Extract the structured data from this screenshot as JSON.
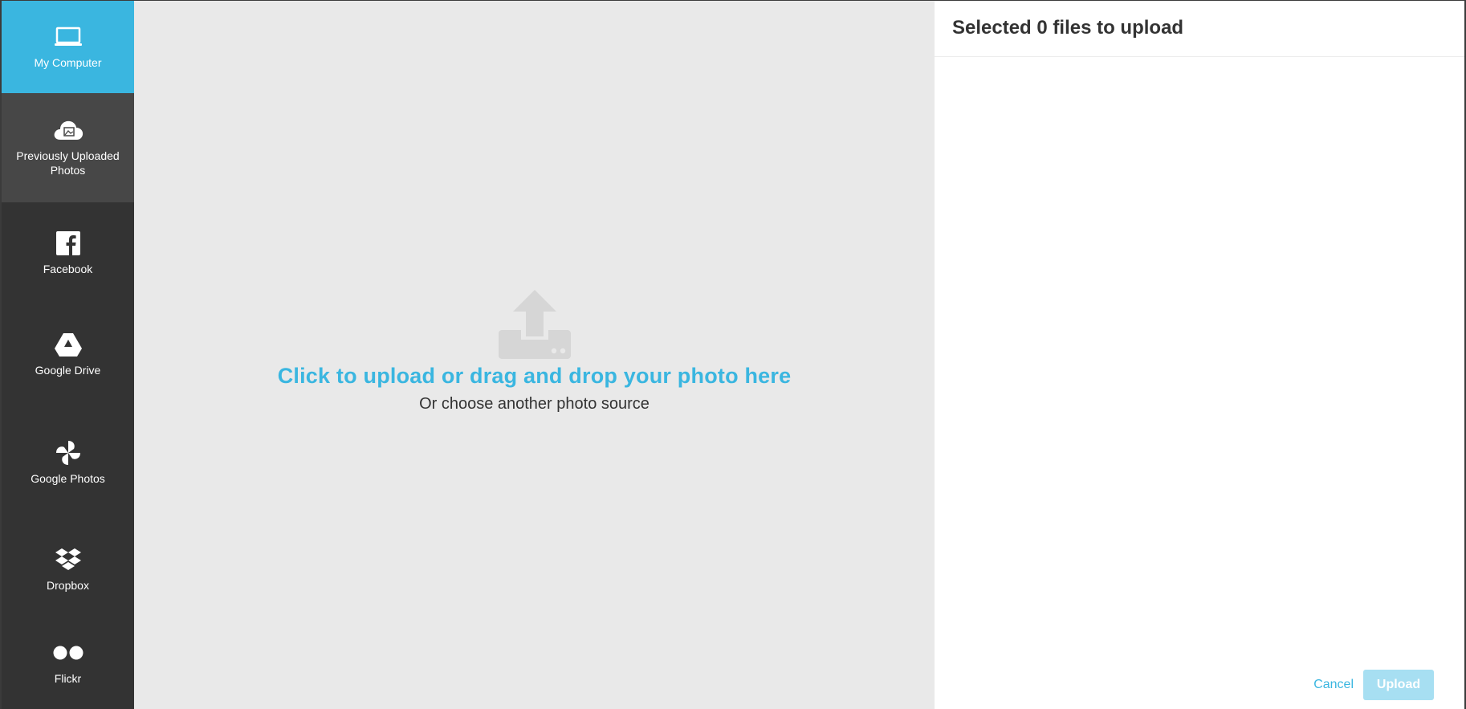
{
  "sidebar": {
    "items": [
      {
        "label": "My Computer",
        "icon": "laptop-icon",
        "state": "active"
      },
      {
        "label": "Previously Uploaded Photos",
        "icon": "cloud-photo-icon",
        "state": "hover"
      },
      {
        "label": "Facebook",
        "icon": "facebook-icon"
      },
      {
        "label": "Google Drive",
        "icon": "google-drive-icon"
      },
      {
        "label": "Google Photos",
        "icon": "google-photos-icon"
      },
      {
        "label": "Dropbox",
        "icon": "dropbox-icon"
      },
      {
        "label": "Flickr",
        "icon": "flickr-icon"
      }
    ]
  },
  "dropzone": {
    "icon": "upload-tray-icon",
    "title": "Click to upload or drag and drop your photo here",
    "subtitle": "Or choose another photo source"
  },
  "panel": {
    "title": "Selected 0 files to upload",
    "cancel_label": "Cancel",
    "upload_label": "Upload"
  },
  "colors": {
    "accent": "#3ab6e0",
    "sidebar_bg": "#333333",
    "dropzone_bg": "#e9e9e9",
    "upload_disabled": "#a7dff2"
  }
}
